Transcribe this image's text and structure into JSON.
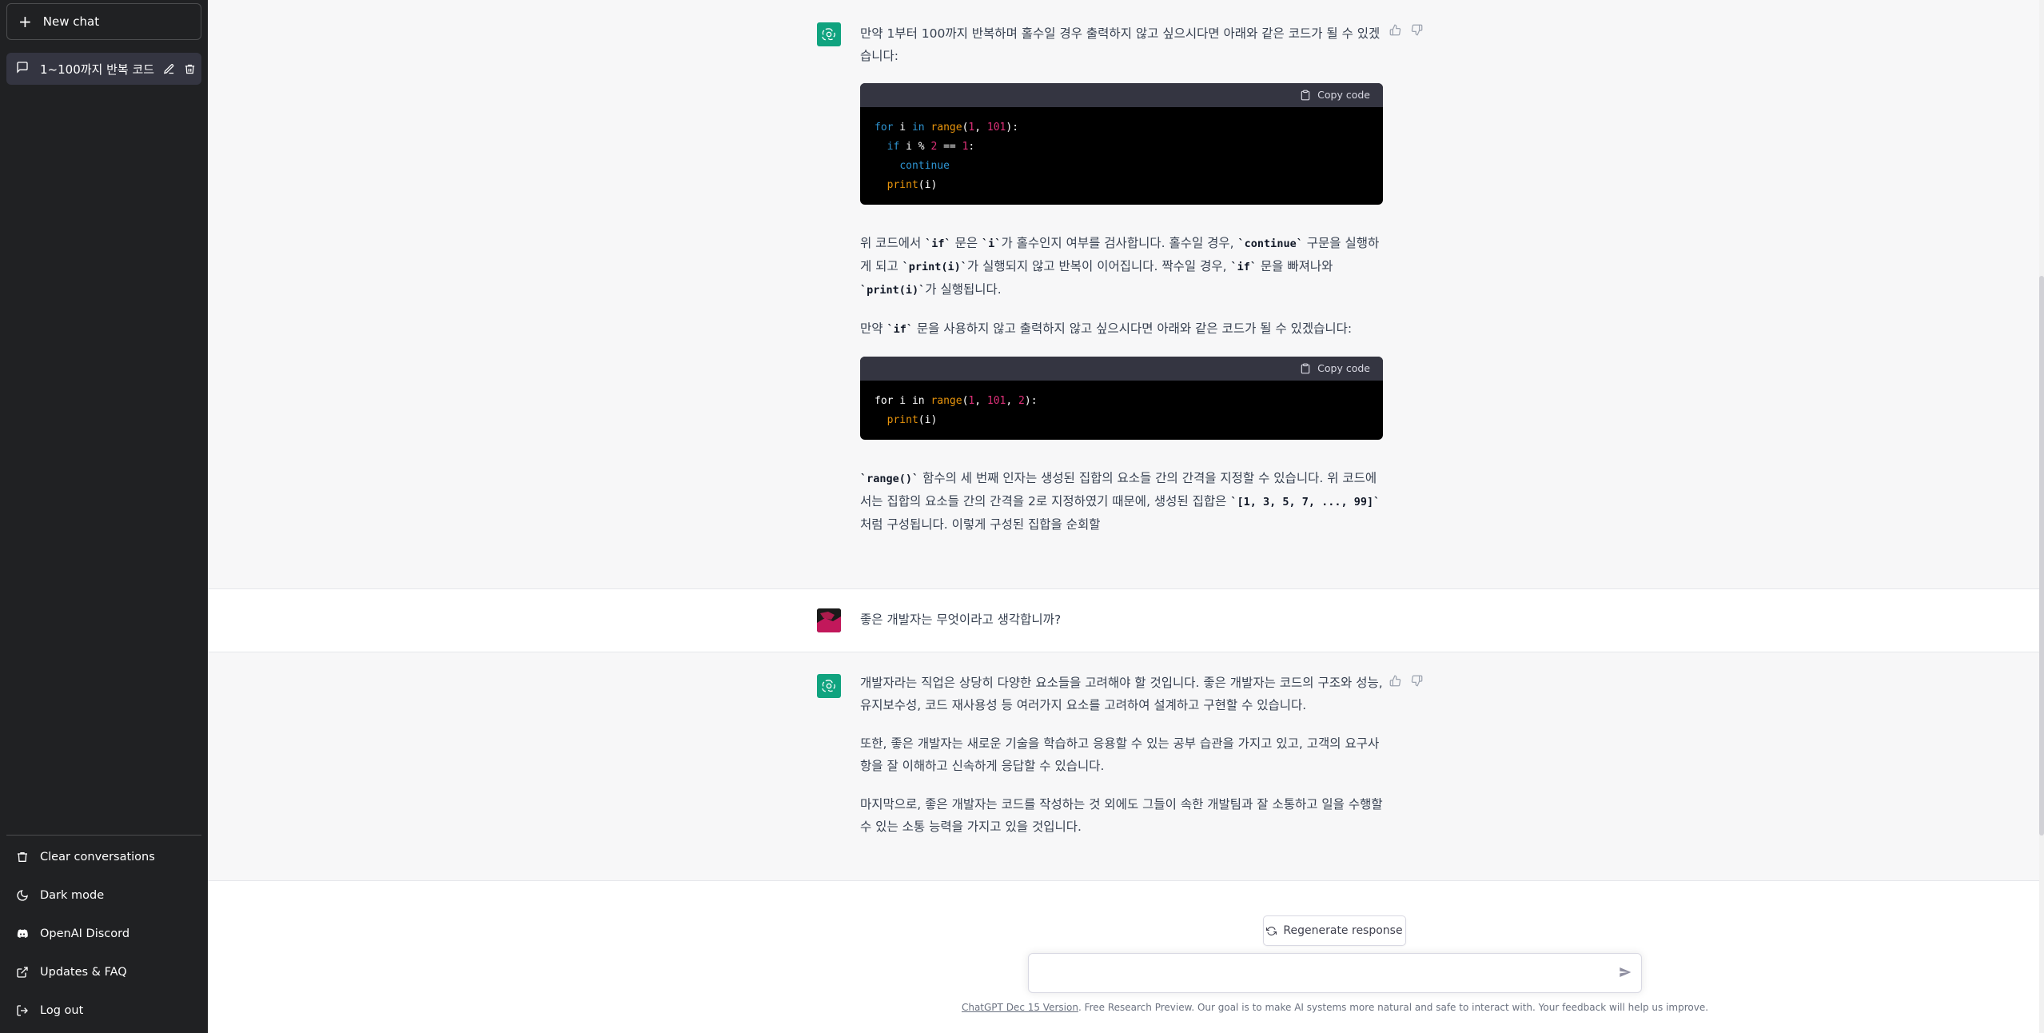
{
  "sidebar": {
    "new_chat": "New chat",
    "conversations": [
      {
        "title": "1~100까지 반복 코드"
      }
    ],
    "links": [
      {
        "label": "Clear conversations",
        "icon": "trash-icon"
      },
      {
        "label": "Dark mode",
        "icon": "moon-icon"
      },
      {
        "label": "OpenAI Discord",
        "icon": "discord-icon"
      },
      {
        "label": "Updates & FAQ",
        "icon": "external-link-icon"
      },
      {
        "label": "Log out",
        "icon": "logout-icon"
      }
    ]
  },
  "messages": {
    "ai1": {
      "p1": "만약 1부터 100까지 반복하며 홀수일 경우 출력하지 않고 싶으시다면 아래와 같은 코드가 될 수 있겠습니다:",
      "copy_code": "Copy code",
      "code1_lines": [
        "for i in range(1, 101):",
        "  if i % 2 == 1:",
        "    continue",
        "  print(i)"
      ],
      "p2_parts": [
        "위 코드에서 ",
        "`if`",
        " 문은 ",
        "`i`",
        "가 홀수인지 여부를 검사합니다. 홀수일 경우, ",
        "`continue`",
        " 구문을 실행하게 되고 ",
        "`print(i)`",
        "가 실행되지 않고 반복이 이어집니다. 짝수일 경우, ",
        "`if`",
        " 문을 빠져나와 ",
        "`print(i)`",
        "가 실행됩니다."
      ],
      "p3_parts": [
        "만약 ",
        "`if`",
        " 문을 사용하지 않고 출력하지 않고 싶으시다면 아래와 같은 코드가 될 수 있겠습니다:"
      ],
      "code2_lines": [
        "for i in range(1, 101, 2):",
        "  print(i)"
      ],
      "p4_parts": [
        "`range()`",
        " 함수의 세 번째 인자는 생성된 집합의 요소들 간의 간격을 지정할 수 있습니다. 위 코드에서는 집합의 요소들 간의 간격을 2로 지정하였기 때문에, 생성된 집합은 ",
        "`[1, 3, 5, 7, ..., 99]`",
        " 처럼 구성됩니다. 이렇게 구성된 집합을 순회할"
      ]
    },
    "user1": {
      "text": "좋은 개발자는 무엇이라고 생각합니까?"
    },
    "ai2": {
      "p1": "개발자라는 직업은 상당히 다양한 요소들을 고려해야 할 것입니다. 좋은 개발자는 코드의 구조와 성능, 유지보수성, 코드 재사용성 등 여러가지 요소를 고려하여 설계하고 구현할 수 있습니다.",
      "p2": "또한, 좋은 개발자는 새로운 기술을 학습하고 응용할 수 있는 공부 습관을 가지고 있고, 고객의 요구사항을 잘 이해하고 신속하게 응답할 수 있습니다.",
      "p3": "마지막으로, 좋은 개발자는 코드를 작성하는 것 외에도 그들이 속한 개발팀과 잘 소통하고 일을 수행할 수 있는 소통 능력을 가지고 있을 것입니다."
    }
  },
  "composer": {
    "regenerate": "Regenerate response",
    "placeholder": ""
  },
  "footer": {
    "version_link": "ChatGPT Dec 15 Version",
    "text": ". Free Research Preview. Our goal is to make AI systems more natural and safe to interact with. Your feedback will help us improve."
  },
  "colors": {
    "sidebar_bg": "#202123",
    "ai_bg": "#f7f7f8",
    "accent": "#10a37f"
  }
}
